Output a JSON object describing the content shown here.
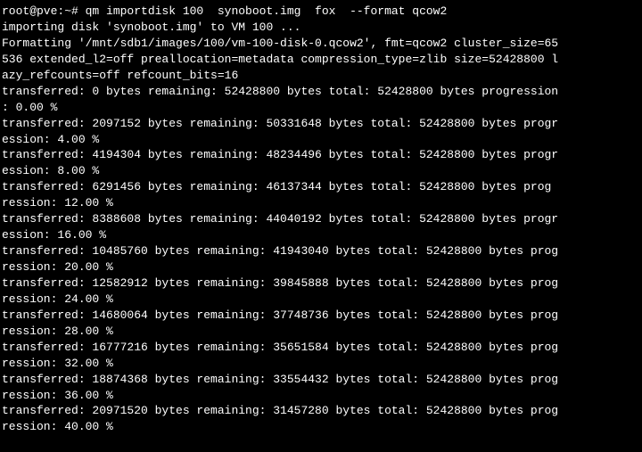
{
  "terminal": {
    "lines": [
      {
        "id": "line-1",
        "text": "root@pve:~# qm importdisk 100  synoboot.img  fox  --format qcow2"
      },
      {
        "id": "line-2",
        "text": "importing disk 'synoboot.img' to VM 100 ..."
      },
      {
        "id": "line-3",
        "text": "Formatting '/mnt/sdb1/images/100/vm-100-disk-0.qcow2', fmt=qcow2 cluster_size=65"
      },
      {
        "id": "line-4",
        "text": "536 extended_l2=off preallocation=metadata compression_type=zlib size=52428800 l"
      },
      {
        "id": "line-5",
        "text": "azy_refcounts=off refcount_bits=16"
      },
      {
        "id": "line-6",
        "text": "transferred: 0 bytes remaining: 52428800 bytes total: 52428800 bytes progression"
      },
      {
        "id": "line-7",
        "text": ": 0.00 %"
      },
      {
        "id": "line-8",
        "text": "transferred: 2097152 bytes remaining: 50331648 bytes total: 52428800 bytes progr"
      },
      {
        "id": "line-9",
        "text": "ession: 4.00 %"
      },
      {
        "id": "line-10",
        "text": "transferred: 4194304 bytes remaining: 48234496 bytes total: 52428800 bytes progr"
      },
      {
        "id": "line-11",
        "text": "ession: 8.00 %"
      },
      {
        "id": "line-12",
        "text": "transferred: 6291456 bytes remaining: 46137344 bytes total: 52428800 bytes prog"
      },
      {
        "id": "line-13",
        "text": "ression: 12.00 %"
      },
      {
        "id": "line-14",
        "text": "transferred: 8388608 bytes remaining: 44040192 bytes total: 52428800 bytes progr"
      },
      {
        "id": "line-15",
        "text": "ession: 16.00 %"
      },
      {
        "id": "line-16",
        "text": "transferred: 10485760 bytes remaining: 41943040 bytes total: 52428800 bytes prog"
      },
      {
        "id": "line-17",
        "text": "ression: 20.00 %"
      },
      {
        "id": "line-18",
        "text": "transferred: 12582912 bytes remaining: 39845888 bytes total: 52428800 bytes prog"
      },
      {
        "id": "line-19",
        "text": "ression: 24.00 %"
      },
      {
        "id": "line-20",
        "text": "transferred: 14680064 bytes remaining: 37748736 bytes total: 52428800 bytes prog"
      },
      {
        "id": "line-21",
        "text": "ression: 28.00 %"
      },
      {
        "id": "line-22",
        "text": "transferred: 16777216 bytes remaining: 35651584 bytes total: 52428800 bytes prog"
      },
      {
        "id": "line-23",
        "text": "ression: 32.00 %"
      },
      {
        "id": "line-24",
        "text": "transferred: 18874368 bytes remaining: 33554432 bytes total: 52428800 bytes prog"
      },
      {
        "id": "line-25",
        "text": "ression: 36.00 %"
      },
      {
        "id": "line-26",
        "text": "transferred: 20971520 bytes remaining: 31457280 bytes total: 52428800 bytes prog"
      },
      {
        "id": "line-27",
        "text": "ression: 40.00 %"
      }
    ]
  }
}
